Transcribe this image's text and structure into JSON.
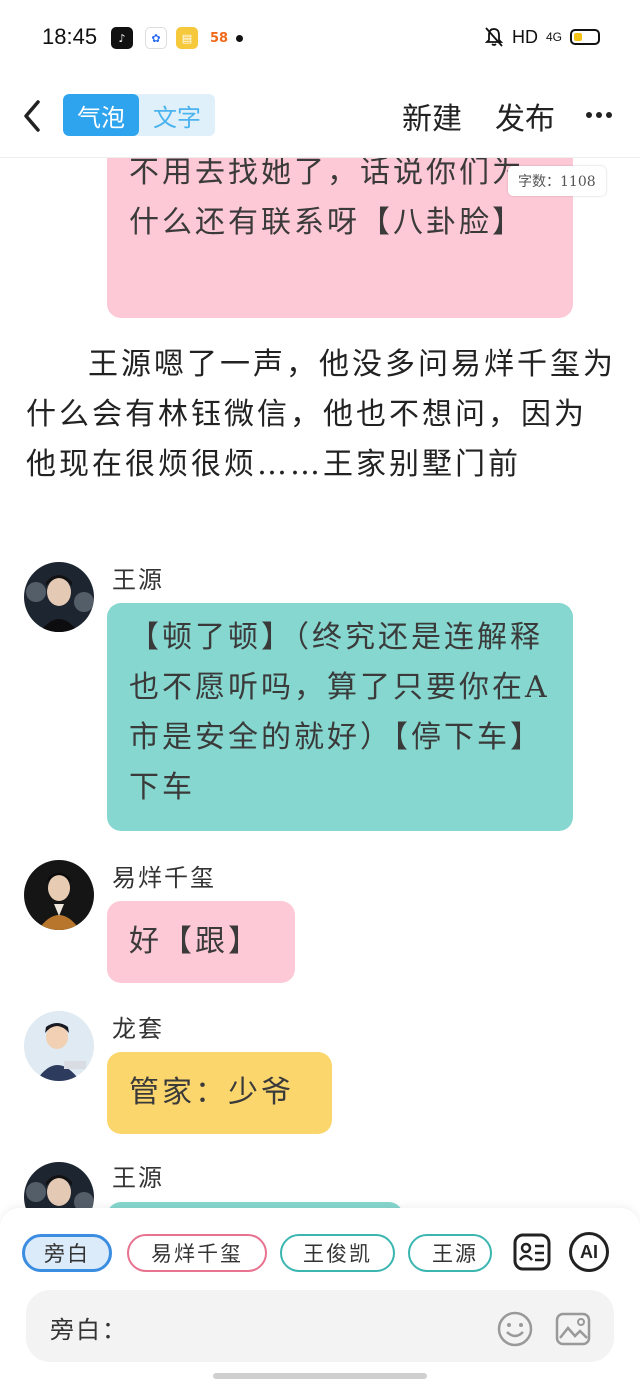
{
  "status_bar": {
    "time": "18:45",
    "apps": [
      "tiktok-icon",
      "baidu-icon",
      "notes-icon",
      "58"
    ],
    "network": "HD",
    "signal": "4G",
    "battery_level": 0.35,
    "colors": {
      "battery": "#f3c316"
    }
  },
  "header": {
    "mode_bubble": "气泡",
    "mode_text": "文字",
    "new_label": "新建",
    "publish_label": "发布"
  },
  "story": {
    "word_count": "字数：1108",
    "top_bubble_text": "不用去找她了，话说你们为什么还有联系呀【八卦脸】",
    "narration": "王源嗯了一声，他没多问易烊千玺为什么会有林钰微信，他也不想问，因为他现在很烦很烦……王家别墅门前",
    "messages": [
      {
        "speaker": "王源",
        "text": "【顿了顿】（终究还是连解释也不愿听吗，算了只要你在A市是安全的就好）【停下车】下车",
        "color": "#86d7cf"
      },
      {
        "speaker": "易烊千玺",
        "text": "好【跟】",
        "color": "#fdc9d6"
      },
      {
        "speaker": "龙套",
        "text": "管家：少爷",
        "color": "#fbd66d"
      },
      {
        "speaker": "王源",
        "text": "",
        "color": "#86d7cf"
      }
    ]
  },
  "composer": {
    "characters": [
      "旁白",
      "易烊千玺",
      "王俊凯",
      "王源"
    ],
    "selected": "旁白",
    "input_prefix": "旁白：",
    "input_value": "",
    "ai_label": "AI"
  },
  "colors": {
    "accent": "#2ea3ee",
    "pink_bubble": "#fdc9d6",
    "teal_bubble": "#86d7cf",
    "yellow_bubble": "#fbd66d"
  }
}
